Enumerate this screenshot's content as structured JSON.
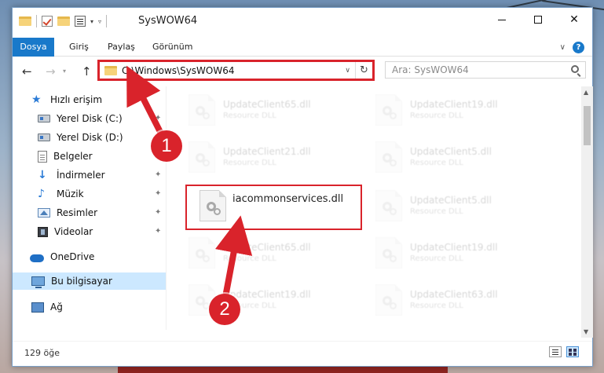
{
  "window": {
    "title": "SysWOW64"
  },
  "ribbon": {
    "tabs": [
      {
        "label": "Dosya"
      },
      {
        "label": "Giriş"
      },
      {
        "label": "Paylaş"
      },
      {
        "label": "Görünüm"
      }
    ],
    "help": "?"
  },
  "address": {
    "path": "C:\\Windows\\SysWOW64"
  },
  "search": {
    "placeholder": "Ara: SysWOW64"
  },
  "sidebar": {
    "items": [
      {
        "label": "Hızlı erişim",
        "icon": "star-icon"
      },
      {
        "label": "Yerel Disk (C:)",
        "icon": "disk-icon",
        "pinned": true
      },
      {
        "label": "Yerel Disk (D:)",
        "icon": "disk-icon",
        "pinned": false
      },
      {
        "label": "Belgeler",
        "icon": "documents-icon",
        "pinned": true
      },
      {
        "label": "İndirmeler",
        "icon": "download-icon",
        "pinned": true
      },
      {
        "label": "Müzik",
        "icon": "music-icon",
        "pinned": true
      },
      {
        "label": "Resimler",
        "icon": "pictures-icon",
        "pinned": true
      },
      {
        "label": "Videolar",
        "icon": "videos-icon",
        "pinned": true
      },
      {
        "label": "OneDrive",
        "icon": "cloud-icon"
      },
      {
        "label": "Bu bilgisayar",
        "icon": "computer-icon",
        "selected": true
      },
      {
        "label": "Ağ",
        "icon": "network-icon"
      }
    ]
  },
  "files": [
    {
      "name": "UpdateClient65.dll",
      "type": "Resource DLL",
      "faded": true
    },
    {
      "name": "UpdateClient19.dll",
      "type": "Resource DLL",
      "faded": true
    },
    {
      "name": "UpdateClient21.dll",
      "type": "Resource DLL",
      "faded": true
    },
    {
      "name": "UpdateClient5.dll",
      "type": "Resource DLL",
      "faded": true
    },
    {
      "name": "iacommonservices.dll",
      "type": "",
      "faded": false
    },
    {
      "name": "UpdateClient5.dll",
      "type": "Resource DLL",
      "faded": true
    },
    {
      "name": "UpdateClient65.dll",
      "type": "Resource DLL",
      "faded": true
    },
    {
      "name": "UpdateClient19.dll",
      "type": "Resource DLL",
      "faded": true
    },
    {
      "name": "UpdateClient19.dll",
      "type": "Resource DLL",
      "faded": true
    },
    {
      "name": "UpdateClient63.dll",
      "type": "Resource DLL",
      "faded": true
    }
  ],
  "status": {
    "count": "129 öğe"
  },
  "annotations": {
    "step1": "1",
    "step2": "2",
    "color": "#d9232b"
  }
}
